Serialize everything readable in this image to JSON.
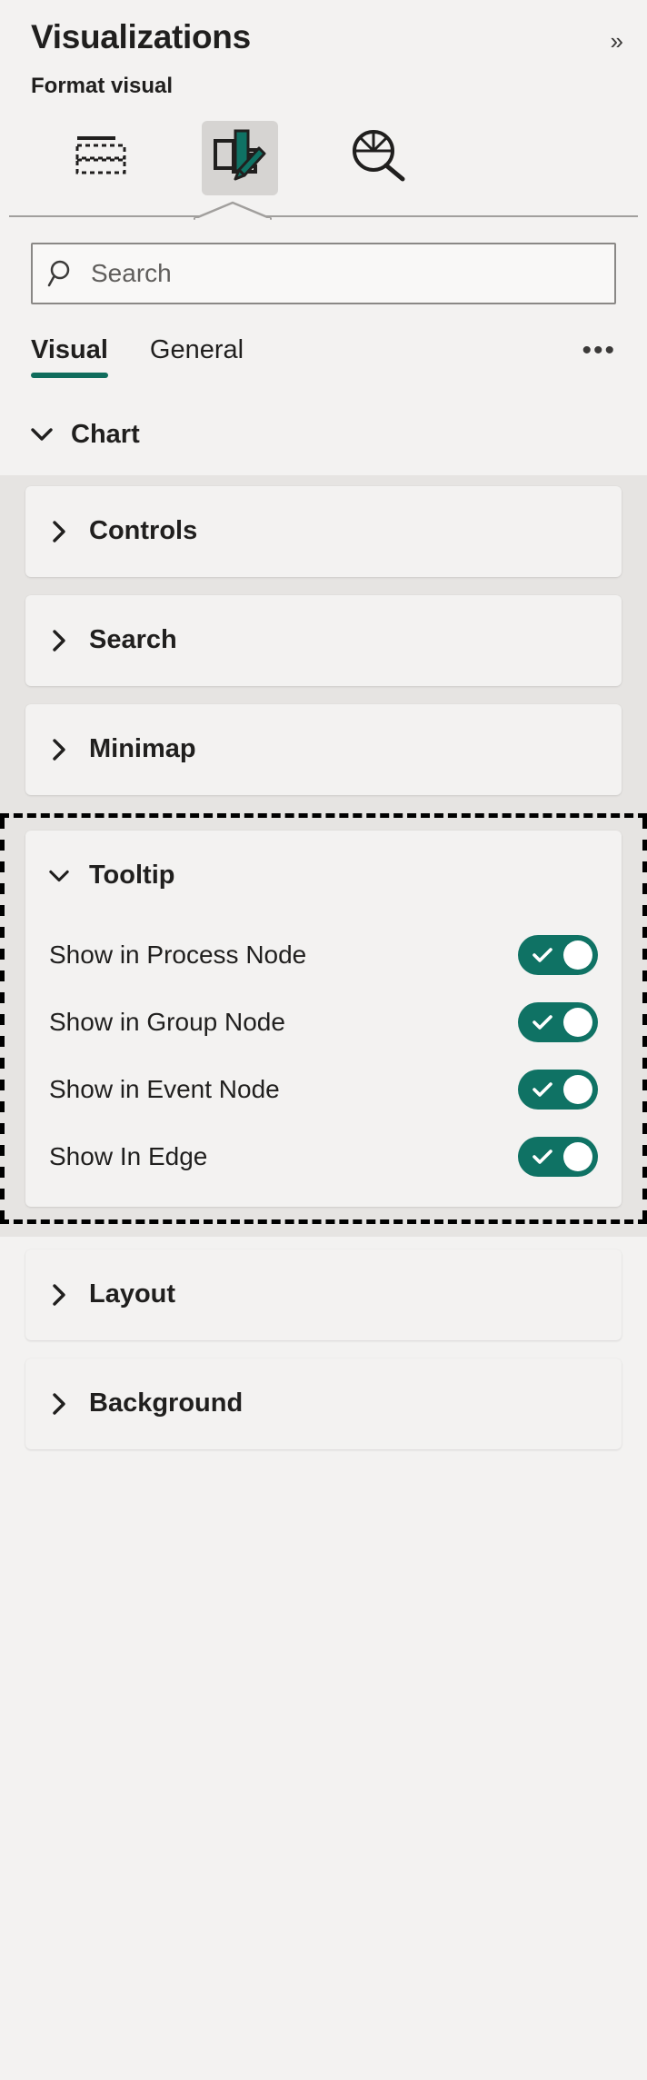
{
  "header": {
    "title": "Visualizations",
    "collapse_icon": "chevron-double-right-icon",
    "collapse_glyph": "»",
    "format_visual_label": "Format visual"
  },
  "icon_tabs": [
    {
      "name": "build-visual-icon",
      "label": "Build visual",
      "selected": false
    },
    {
      "name": "format-visual-icon",
      "label": "Format visual",
      "selected": true
    },
    {
      "name": "analytics-icon",
      "label": "Analytics",
      "selected": false
    }
  ],
  "search": {
    "placeholder": "Search",
    "value": "",
    "icon": "search-icon"
  },
  "tabs": {
    "items": [
      {
        "label": "Visual",
        "active": true
      },
      {
        "label": "General",
        "active": false
      }
    ],
    "more_glyph": "•••",
    "more_label": "More options"
  },
  "section": {
    "title": "Chart",
    "expanded": true,
    "chevron": "chevron-down-icon"
  },
  "cards": [
    {
      "title": "Controls",
      "expanded": false,
      "chevron": "chevron-right-icon"
    },
    {
      "title": "Search",
      "expanded": false,
      "chevron": "chevron-right-icon"
    },
    {
      "title": "Minimap",
      "expanded": false,
      "chevron": "chevron-right-icon"
    }
  ],
  "tooltip_card": {
    "title": "Tooltip",
    "expanded": true,
    "chevron": "chevron-down-icon",
    "focused": true,
    "toggles": [
      {
        "label": "Show in Process Node",
        "on": true
      },
      {
        "label": "Show in Group Node",
        "on": true
      },
      {
        "label": "Show in Event Node",
        "on": true
      },
      {
        "label": "Show In Edge",
        "on": true
      }
    ]
  },
  "bottom_cards": [
    {
      "title": "Layout",
      "expanded": false,
      "chevron": "chevron-right-icon"
    },
    {
      "title": "Background",
      "expanded": false,
      "chevron": "chevron-right-icon"
    }
  ],
  "colors": {
    "accent_green": "#0f6c5c",
    "toggle_on": "#0f7264",
    "panel_bg": "#f3f2f1",
    "cards_region_bg": "#e6e4e2",
    "text": "#201f1e",
    "border": "#8a8886"
  }
}
